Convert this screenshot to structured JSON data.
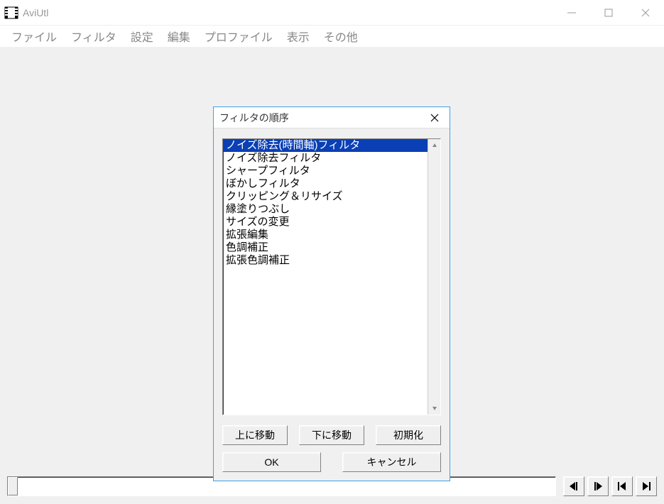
{
  "window": {
    "title": "AviUtl"
  },
  "menu": {
    "items": [
      "ファイル",
      "フィルタ",
      "設定",
      "編集",
      "プロファイル",
      "表示",
      "その他"
    ]
  },
  "dialog": {
    "title": "フィルタの順序",
    "filters": [
      "ノイズ除去(時間軸)フィルタ",
      "ノイズ除去フィルタ",
      "シャープフィルタ",
      "ぼかしフィルタ",
      "クリッピング＆リサイズ",
      "縁塗りつぶし",
      "サイズの変更",
      "拡張編集",
      "色調補正",
      "拡張色調補正"
    ],
    "selected_index": 0,
    "buttons": {
      "move_up": "上に移動",
      "move_down": "下に移動",
      "reset": "初期化",
      "ok": "OK",
      "cancel": "キャンセル"
    }
  }
}
